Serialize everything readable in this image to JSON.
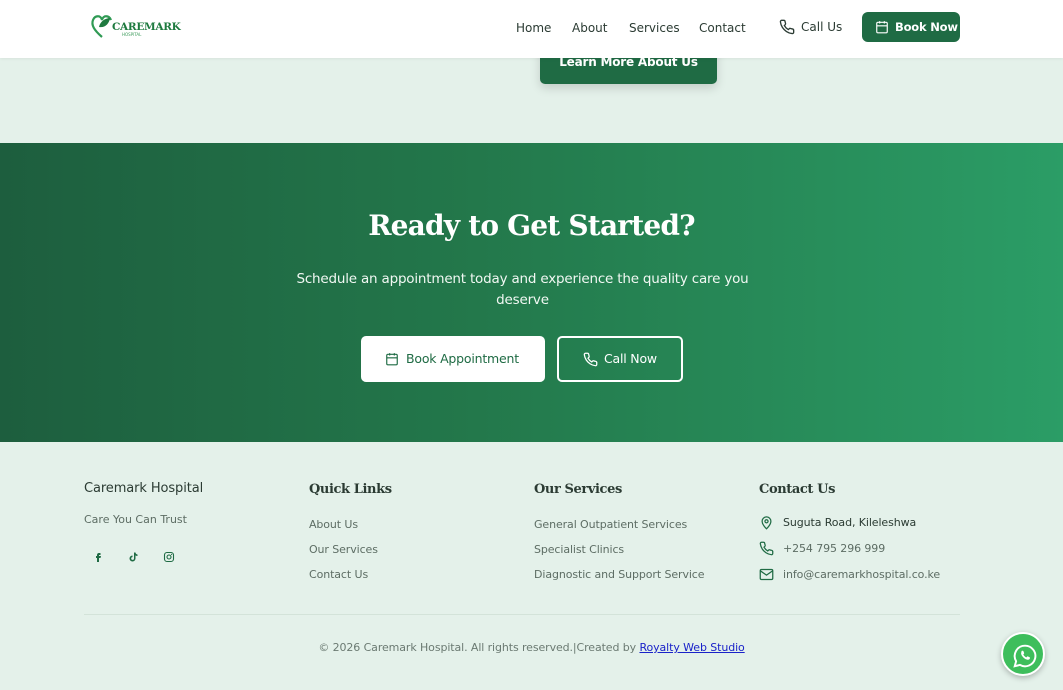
{
  "header": {
    "logo_text": "CAREMARK",
    "logo_sub": "HOSPITAL",
    "nav": [
      "Home",
      "About",
      "Services",
      "Contact"
    ],
    "call_label": "Call Us",
    "book_label": "Book Now"
  },
  "about": {
    "learn_more_label": "Learn More About Us"
  },
  "cta": {
    "title": "Ready to Get Started?",
    "subtitle": "Schedule an appointment today and experience the quality care you deserve",
    "book_label": "Book Appointment",
    "call_label": "Call Now"
  },
  "footer": {
    "brand": "Caremark Hospital",
    "tagline": "Care You Can Trust",
    "social_icons": [
      "facebook-icon",
      "tiktok-icon",
      "instagram-icon"
    ],
    "quick_links_heading": "Quick Links",
    "quick_links": [
      "About Us",
      "Our Services",
      "Contact Us"
    ],
    "services_heading": "Our Services",
    "services": [
      "General Outpatient Services",
      "Specialist Clinics",
      "Diagnostic and Support Service"
    ],
    "contact_heading": "Contact Us",
    "address": "Suguta Road, Kileleshwa",
    "phone": "+254 795 296 999",
    "email": "info@caremarkhospital.co.ke",
    "copyright_text": "© 2026 Caremark Hospital. All rights reserved.|Created by ",
    "credit_link": "Royalty Web Studio"
  },
  "colors": {
    "brand_green": "#1f6b44",
    "cta_gradient_start": "#1d5e3e",
    "cta_gradient_end": "#2b9d66",
    "page_background": "#e4f1ea",
    "whatsapp_green": "#3ebe5c",
    "credit_link": "#1a22c9"
  }
}
